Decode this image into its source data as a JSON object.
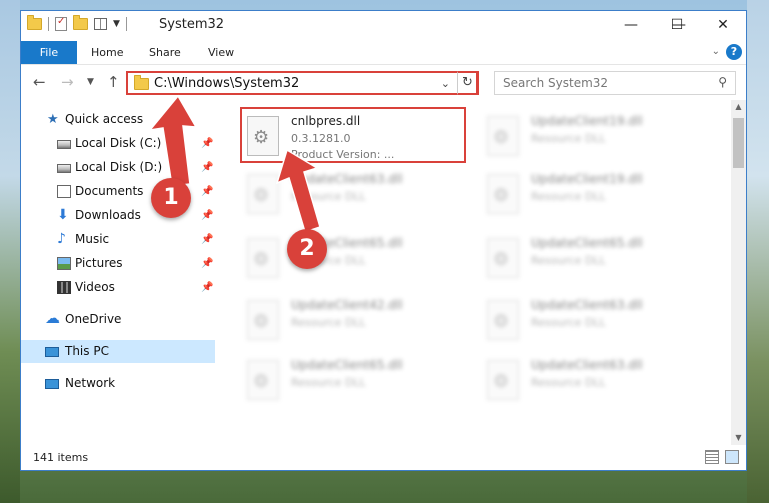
{
  "window": {
    "title": "System32",
    "controls": {
      "minimize": "—",
      "maximize": "☐",
      "close": "✕"
    }
  },
  "ribbon": {
    "tabs": [
      "File",
      "Home",
      "Share",
      "View"
    ]
  },
  "nav": {
    "address": "C:\\Windows\\System32",
    "search_placeholder": "Search System32"
  },
  "sidebar": {
    "items": [
      {
        "label": "Quick access",
        "icon": "star-icon"
      },
      {
        "label": "Local Disk (C:)",
        "icon": "disk-icon",
        "pinned": true
      },
      {
        "label": "Local Disk (D:)",
        "icon": "disk-icon",
        "pinned": true
      },
      {
        "label": "Documents",
        "icon": "documents-icon",
        "pinned": true
      },
      {
        "label": "Downloads",
        "icon": "downloads-icon",
        "pinned": true
      },
      {
        "label": "Music",
        "icon": "music-icon",
        "pinned": true
      },
      {
        "label": "Pictures",
        "icon": "pictures-icon",
        "pinned": true
      },
      {
        "label": "Videos",
        "icon": "videos-icon",
        "pinned": true
      },
      {
        "label": "OneDrive",
        "icon": "cloud-icon"
      },
      {
        "label": "This PC",
        "icon": "pc-icon",
        "selected": true
      },
      {
        "label": "Network",
        "icon": "network-icon"
      }
    ]
  },
  "files": {
    "highlighted": {
      "name": "cnlbpres.dll",
      "version": "0.3.1281.0",
      "product": "Product Version:    ..."
    },
    "others": [
      {
        "name": "UpdateClient19.dll",
        "type": "Resource DLL"
      },
      {
        "name": "UpdateClient63.dll",
        "type": "Resource DLL"
      },
      {
        "name": "UpdateClient19.dll",
        "type": "Resource DLL"
      },
      {
        "name": "UpdateClient65.dll",
        "type": "Resource DLL"
      },
      {
        "name": "UpdateClient65.dll",
        "type": "Resource DLL"
      },
      {
        "name": "UpdateClient42.dll",
        "type": "Resource DLL"
      },
      {
        "name": "UpdateClient63.dll",
        "type": "Resource DLL"
      },
      {
        "name": "UpdateClient65.dll",
        "type": "Resource DLL"
      },
      {
        "name": "UpdateClient63.dll",
        "type": "Resource DLL"
      }
    ]
  },
  "status": {
    "item_count": "141 items"
  },
  "annotations": {
    "step1": "1",
    "step2": "2",
    "color": "#d9413a"
  }
}
